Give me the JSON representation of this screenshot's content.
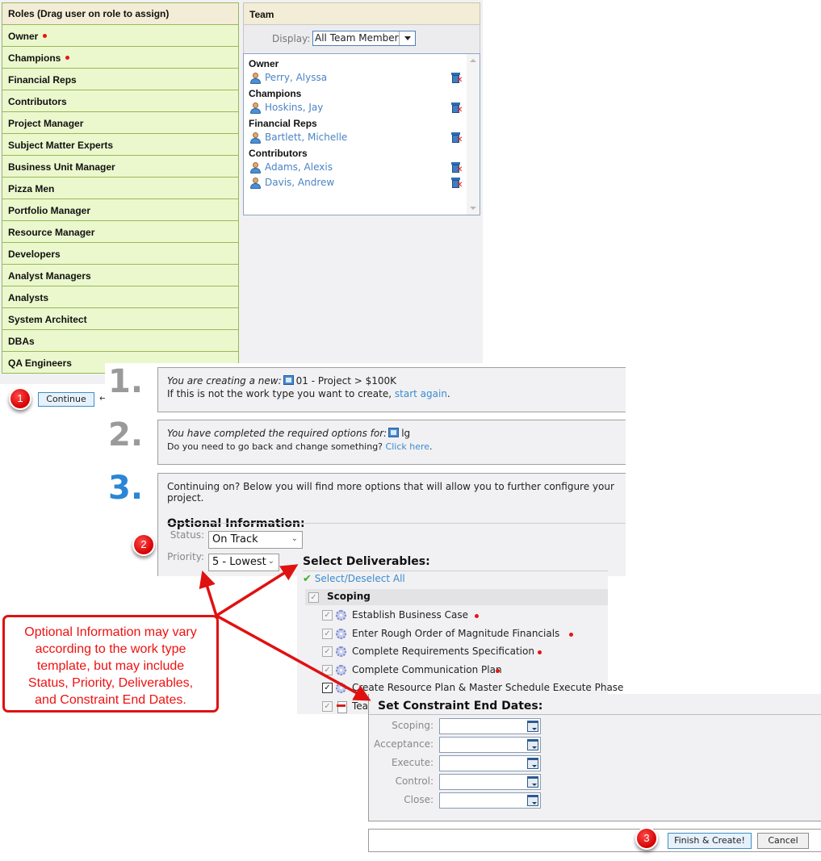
{
  "roles": {
    "header": "Roles (Drag user on role to assign)",
    "items": [
      {
        "label": "Owner",
        "required": true
      },
      {
        "label": "Champions",
        "required": true
      },
      {
        "label": "Financial Reps",
        "required": false
      },
      {
        "label": "Contributors",
        "required": false
      },
      {
        "label": "Project Manager",
        "required": false
      },
      {
        "label": "Subject Matter Experts",
        "required": false
      },
      {
        "label": "Business Unit Manager",
        "required": false
      },
      {
        "label": "Pizza Men",
        "required": false
      },
      {
        "label": "Portfolio Manager",
        "required": false
      },
      {
        "label": "Resource Manager",
        "required": false
      },
      {
        "label": "Developers",
        "required": false
      },
      {
        "label": "Analyst Managers",
        "required": false
      },
      {
        "label": "Analysts",
        "required": false
      },
      {
        "label": "System Architect",
        "required": false
      },
      {
        "label": "DBAs",
        "required": false
      },
      {
        "label": "QA Engineers",
        "required": false
      }
    ]
  },
  "team": {
    "header": "Team",
    "display_label": "Display:",
    "display_value": "All Team Members",
    "groups": [
      {
        "label": "Owner",
        "members": [
          "Perry, Alyssa"
        ]
      },
      {
        "label": "Champions",
        "members": [
          "Hoskins, Jay"
        ]
      },
      {
        "label": "Financial Reps",
        "members": [
          "Bartlett, Michelle"
        ]
      },
      {
        "label": "Contributors",
        "members": [
          "Adams, Alexis",
          "Davis, Andrew"
        ]
      }
    ]
  },
  "continue_button": "Continue",
  "continue_arrow": "←",
  "badges": [
    "1",
    "2",
    "3"
  ],
  "steps": {
    "step1": {
      "number": "1.",
      "intro": "You are creating a new:",
      "work_type": "01 - Project > $100K",
      "line2_prefix": "If this is not the work type you want to create, ",
      "link": "start again",
      "line2_suffix": "."
    },
    "step2": {
      "number": "2.",
      "intro": "You have completed the required options for:",
      "value": "lg",
      "line2_prefix": "Do you need to go back and change something? ",
      "link": "Click here",
      "line2_suffix": "."
    },
    "step3": {
      "number": "3.",
      "intro": "Continuing on? Below you will find more options that will allow you to further configure your project.",
      "optional_heading": "Optional Information:",
      "status_label": "Status:",
      "status_value": "On Track",
      "priority_label": "Priority:",
      "priority_value": "5 - Lowest"
    }
  },
  "deliverables": {
    "heading": "Select Deliverables:",
    "select_all": "Select/Deselect All",
    "group": "Scoping",
    "items": [
      {
        "label": "Establish Business Case",
        "required": true,
        "icon": "gear",
        "checked": true
      },
      {
        "label": "Enter Rough Order of Magnitude Financials",
        "required": true,
        "icon": "gear",
        "checked": true
      },
      {
        "label": "Complete Requirements Specification",
        "required": true,
        "icon": "gear",
        "checked": true
      },
      {
        "label": "Complete Communication Plan",
        "required": true,
        "icon": "gear",
        "checked": true
      },
      {
        "label": "Create Resource Plan & Master Schedule Execute Phase",
        "required": false,
        "icon": "gear",
        "checked": true
      },
      {
        "label": "Tea",
        "required": false,
        "icon": "pdf",
        "checked": true
      }
    ]
  },
  "constraints": {
    "heading": "Set Constraint End Dates:",
    "fields": [
      {
        "label": "Scoping:",
        "value": ""
      },
      {
        "label": "Acceptance:",
        "value": ""
      },
      {
        "label": "Execute:",
        "value": ""
      },
      {
        "label": "Control:",
        "value": ""
      },
      {
        "label": "Close:",
        "value": ""
      }
    ]
  },
  "actions": {
    "finish": "Finish & Create!",
    "cancel": "Cancel"
  },
  "callout": {
    "text_lines": [
      "Optional Information may vary",
      "according to the work type",
      "template, but may include",
      "Status, Priority, Deliverables,",
      "and Constraint End Dates."
    ]
  },
  "colors": {
    "annotation_red": "#e01111",
    "link_blue": "#3b8bd0",
    "step3_blue": "#2a86d6",
    "role_bg": "#ebf8cd",
    "header_bg": "#f3ecd6"
  }
}
